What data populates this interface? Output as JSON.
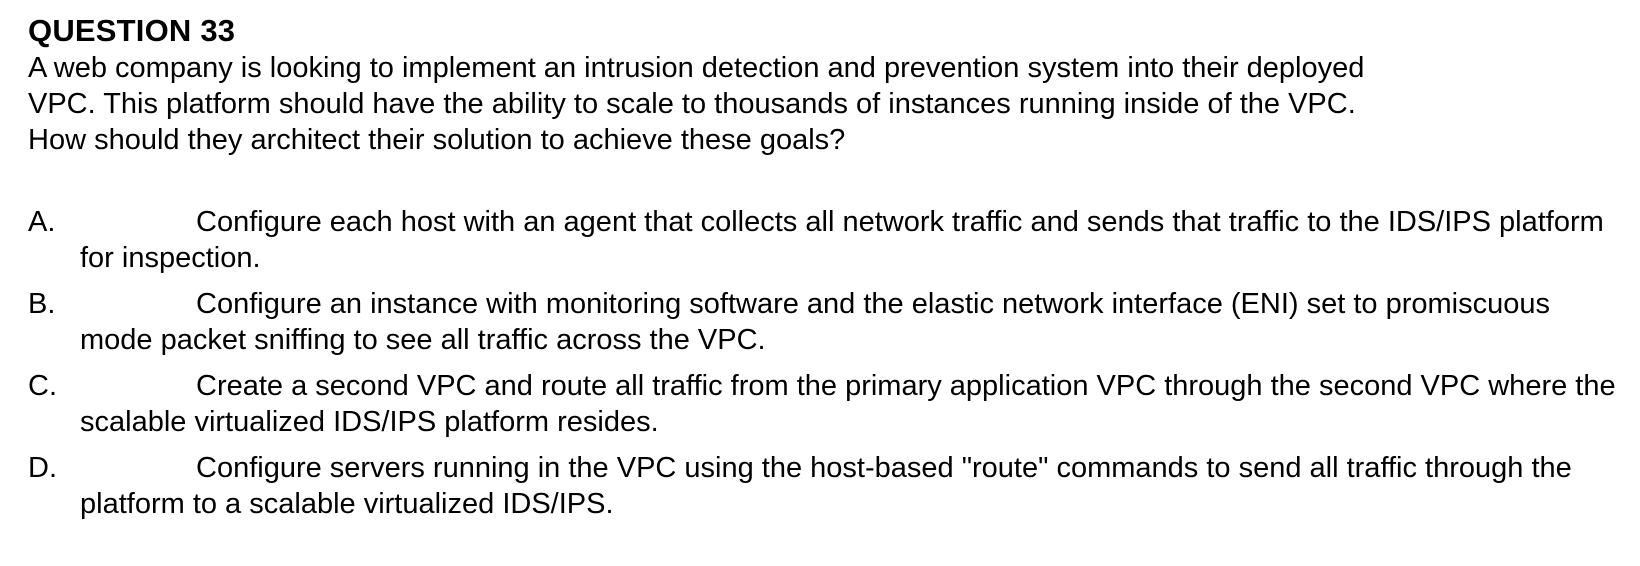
{
  "question": {
    "title": "QUESTION 33",
    "lines": [
      "A web company is looking to implement an intrusion detection and prevention system into their deployed",
      "VPC. This platform should have the ability to scale to thousands of instances running inside of the VPC.",
      "How should they architect their solution to achieve these goals?"
    ]
  },
  "options": [
    {
      "letter": "A.",
      "text": "Configure each host with an agent that collects all network traffic and sends that traffic to the IDS/IPS platform for inspection."
    },
    {
      "letter": "B.",
      "text": "Configure an instance with monitoring software and the elastic network interface (ENI) set to promiscuous mode packet sniffing to see all traffic across the VPC."
    },
    {
      "letter": "C.",
      "text": "Create a second VPC and route all traffic from the primary application VPC through the second VPC where the scalable virtualized IDS/IPS platform resides."
    },
    {
      "letter": "D.",
      "text": "Configure servers running in the VPC using the host-based \"route\" commands to send all traffic through the platform to a scalable virtualized IDS/IPS."
    }
  ]
}
